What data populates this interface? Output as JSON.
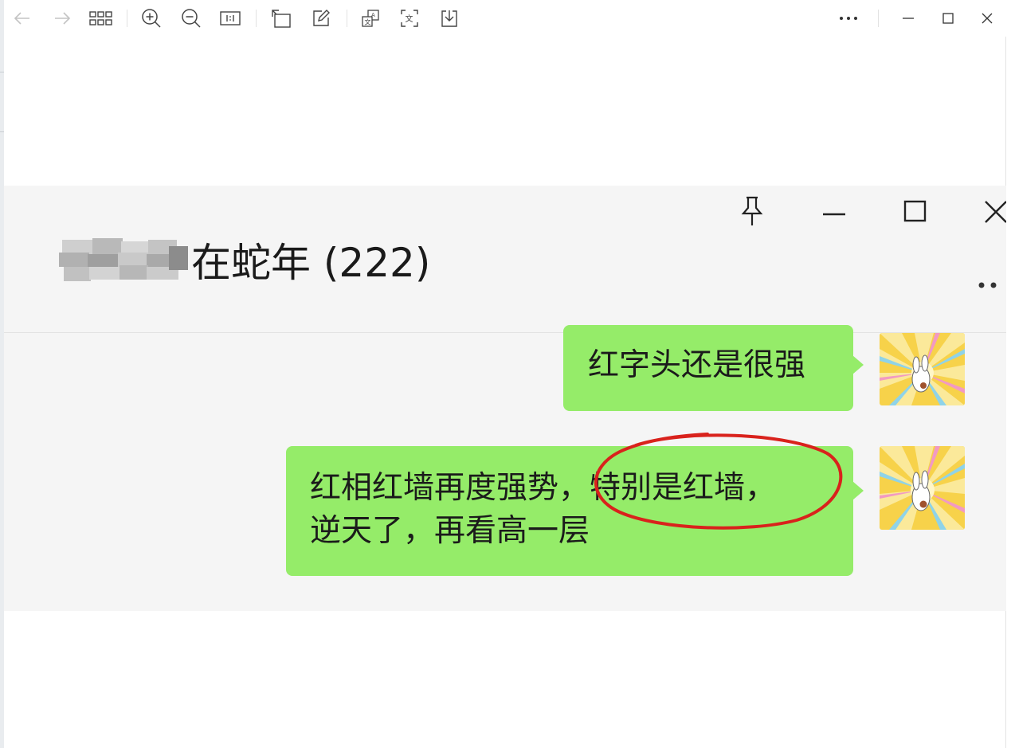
{
  "toolbar": {
    "buttons": [
      "back-arrow-icon",
      "forward-arrow-icon",
      "grid-view-icon",
      "zoom-in-icon",
      "zoom-out-icon",
      "actual-size-icon",
      "rotate-icon",
      "edit-icon",
      "translate-image-icon",
      "extract-text-icon",
      "save-download-icon",
      "more-options-icon",
      "minimize-icon",
      "maximize-icon",
      "close-icon"
    ]
  },
  "chat": {
    "title": "在蛇年 (222)",
    "window_controls": [
      "pin-icon",
      "minimize-icon",
      "maximize-icon",
      "close-icon"
    ],
    "messages": [
      {
        "text": "红字头还是很强",
        "sender": "self"
      },
      {
        "line1": "红相红墙再度强势，特别是红墙，",
        "line2": "逆天了，再看高一层",
        "sender": "self"
      }
    ]
  },
  "colors": {
    "bubble_green": "#95ec69",
    "chat_background": "#f5f5f5",
    "annotation_red": "#d9221c"
  }
}
